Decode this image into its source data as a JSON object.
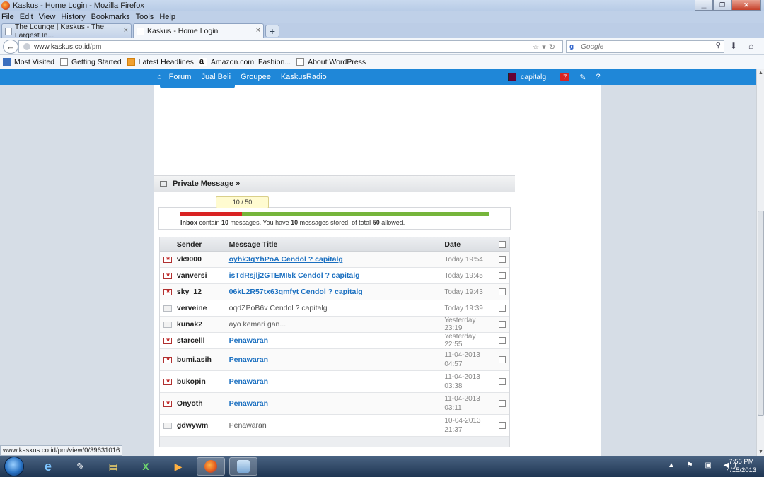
{
  "window": {
    "title": "Kaskus - Home Login - Mozilla Firefox",
    "btn_min": "▁",
    "btn_max": "❐",
    "btn_close": "✕"
  },
  "menu": [
    "File",
    "Edit",
    "View",
    "History",
    "Bookmarks",
    "Tools",
    "Help"
  ],
  "tabs": [
    {
      "label": "The Lounge | Kaskus - The Largest In...",
      "close": "×"
    },
    {
      "label": "Kaskus - Home Login",
      "close": "×"
    }
  ],
  "new_tab": "+",
  "nav": {
    "back": "←",
    "url_host": "www.kaskus.co.id",
    "url_path": "/pm",
    "url_icons": "☆▾↻",
    "search_engine": "g",
    "search_placeholder": "Google",
    "search_icon": "⚲",
    "download": "⬇",
    "home": "⌂"
  },
  "bookmarks": [
    "Most Visited",
    "Getting Started",
    "Latest Headlines",
    "Amazon.com: Fashion...",
    "About WordPress"
  ],
  "amazon_glyph": "a",
  "site": {
    "home_icon": "⌂",
    "nav_links": [
      "Forum",
      "Jual Beli",
      "Groupee",
      "KaskusRadio"
    ],
    "username": "capitalg",
    "notif_count": "7",
    "edit_icon": "✎",
    "help_icon": "?"
  },
  "pm": {
    "title": "Private Message »",
    "quota_tip": "10 / 50",
    "quota_fraction": 0.2,
    "quota": {
      "inbox": "Inbox",
      "t1": " contain ",
      "count": "10",
      "t2": " messages. You have ",
      "stored": "10",
      "t3": " messages stored, of total ",
      "total": "50",
      "t4": " allowed."
    },
    "headers": {
      "sender": "Sender",
      "title": "Message Title",
      "date": "Date"
    },
    "rows": [
      {
        "sender": "vk9000",
        "title": "oyhk3qYhPoA Cendol ? capitalg",
        "date": "Today 19:54",
        "unread": true,
        "style": "link-u"
      },
      {
        "sender": "vanversi",
        "title": "isTdRsjlj2GTEMI5k Cendol ? capitalg",
        "date": "Today 19:45",
        "unread": true,
        "style": "link"
      },
      {
        "sender": "sky_12",
        "title": "06kL2R57tx63qmfyt Cendol ? capitalg",
        "date": "Today 19:43",
        "unread": true,
        "style": "link"
      },
      {
        "sender": "verveine",
        "title": "oqdZPoB6v Cendol ? capitalg",
        "date": "Today 19:39",
        "unread": false,
        "style": "read"
      },
      {
        "sender": "kunak2",
        "title": "ayo kemari gan...",
        "date": "Yesterday 23:19",
        "unread": false,
        "style": "read"
      },
      {
        "sender": "starcelll",
        "title": "Penawaran",
        "date": "Yesterday 22:55",
        "unread": true,
        "style": "link"
      },
      {
        "sender": "bumi.asih",
        "title": "Penawaran",
        "date": "11-04-2013 04:57",
        "unread": true,
        "style": "link"
      },
      {
        "sender": "bukopin",
        "title": "Penawaran",
        "date": "11-04-2013 03:38",
        "unread": true,
        "style": "link"
      },
      {
        "sender": "Onyoth",
        "title": "Penawaran",
        "date": "11-04-2013 03:11",
        "unread": true,
        "style": "link"
      },
      {
        "sender": "gdwywm",
        "title": "Penawaran",
        "date": "10-04-2013 21:37",
        "unread": false,
        "style": "read"
      }
    ]
  },
  "scroll": {
    "up": "▲",
    "down": "▼"
  },
  "statusbar": "www.kaskus.co.id/pm/view/0/39631016",
  "taskbar": {
    "apps": [
      "e",
      "✎",
      "▤",
      "X",
      "▶",
      "",
      ""
    ],
    "tray": "▲ ⚑ ▣ ◀)",
    "time": "7:56 PM",
    "date": "4/15/2013"
  }
}
